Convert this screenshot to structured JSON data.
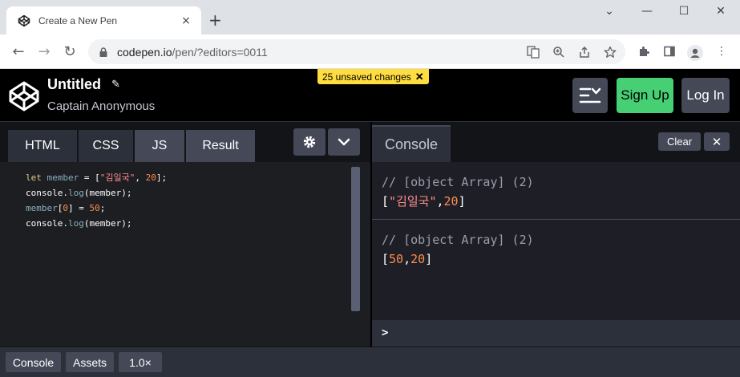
{
  "browser": {
    "tab_title": "Create a New Pen",
    "tab_close": "×",
    "new_tab": "+",
    "url_host": "codepen.io",
    "url_path": "/pen/?editors=0011",
    "win_min": "⌄",
    "win_minimize": "—",
    "win_maximize": "☐",
    "win_close": "✕"
  },
  "header": {
    "title": "Untitled",
    "author": "Captain Anonymous",
    "unsaved": "25 unsaved changes",
    "signup": "Sign Up",
    "login": "Log In"
  },
  "editor": {
    "tabs": [
      "HTML",
      "CSS",
      "JS",
      "Result"
    ],
    "code": {
      "l1_kw": "let",
      "l1_var": " member",
      "l1_eq": " = [",
      "l1_str": "\"김일국\"",
      "l1_comma": ", ",
      "l1_num": "20",
      "l1_end": "];",
      "l2_obj": "console.",
      "l2_fn": "log",
      "l2_args": "(member);",
      "l3_var": "member",
      "l3_open": "[",
      "l3_idx": "0",
      "l3_mid": "] = ",
      "l3_num": "50",
      "l3_end": ";",
      "l4_obj": "console.",
      "l4_fn": "log",
      "l4_args": "(member);"
    }
  },
  "console": {
    "title": "Console",
    "clear": "Clear",
    "close": "✕",
    "prompt": ">",
    "entries": [
      {
        "comment": "// [object Array] (2)",
        "open": "[",
        "str": "\"김일국\"",
        "comma": ",",
        "num": "20",
        "close": "]"
      },
      {
        "comment": "// [object Array] (2)",
        "open": "[",
        "num1": "50",
        "comma": ",",
        "num2": "20",
        "close": "]"
      }
    ]
  },
  "footer": {
    "console": "Console",
    "assets": "Assets",
    "zoom": "1.0×"
  },
  "colors": {
    "accent_green": "#47cf73",
    "unsaved_yellow": "#ffdd40",
    "button_gray": "#444857"
  }
}
